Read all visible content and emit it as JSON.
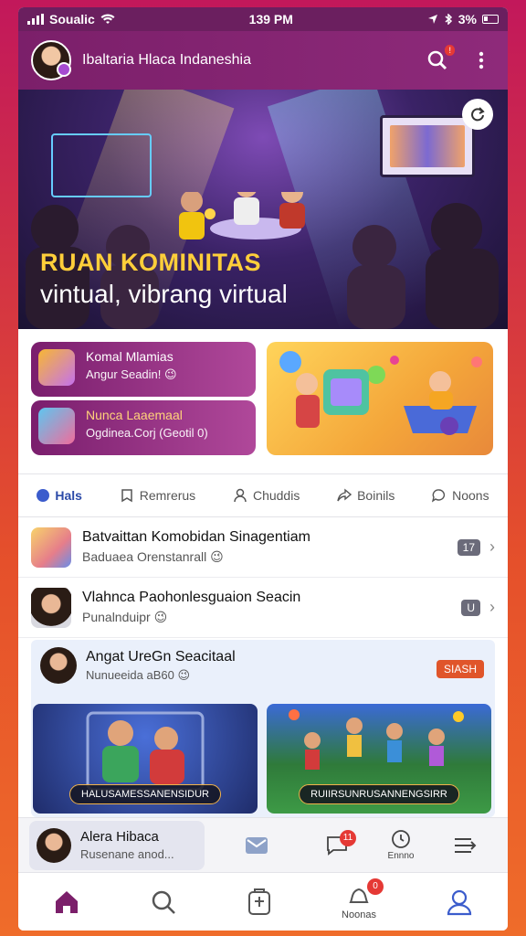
{
  "status_bar": {
    "carrier": "Soualic",
    "time": "139 PM",
    "battery": "3%"
  },
  "app_bar": {
    "title": "Ibaltaria Hlaca Indaneshia",
    "notification_count": "!"
  },
  "hero": {
    "title": "RUAN KOMINITAS",
    "subtitle": "vintual, vibrang virtual"
  },
  "promo_cards": [
    {
      "title": "Komal Mlamias",
      "subtitle": "Angur Seadin! 😉"
    },
    {
      "title": "Nunca Laaemaal",
      "subtitle": "Ogdinea.Corj (Geotil 0)"
    }
  ],
  "tabs": [
    {
      "label": "Hals",
      "icon": "dot-icon",
      "active": true
    },
    {
      "label": "Remrerus",
      "icon": "bookmark-icon",
      "active": false
    },
    {
      "label": "Chuddis",
      "icon": "person-icon",
      "active": false
    },
    {
      "label": "Boinils",
      "icon": "share-icon",
      "active": false
    },
    {
      "label": "Noons",
      "icon": "chat-icon",
      "active": false
    }
  ],
  "list_items": [
    {
      "title": "Batvaittan Komobidan Sinagentiam",
      "subtitle": "Baduaea Orenstanrall 😉",
      "tag": "17"
    },
    {
      "title": "Vlahnca Paohonlesguaion Seacin",
      "subtitle": "Punalnduipr 😉",
      "tag": "U"
    }
  ],
  "feature": {
    "title": "Angat UreGn Seacitaal",
    "subtitle": "Nunueeida aB60 😉",
    "button": "SIASH",
    "tiles": [
      {
        "caption": "HALUSAMESSANENSIDUR"
      },
      {
        "caption": "RUIIRSUNRUSANNENGSIRR"
      }
    ]
  },
  "dock": {
    "name": "Alera Hibaca",
    "status": "Rusenane anod...",
    "badge": "11",
    "item_label": "Ennno"
  },
  "bottom_nav": {
    "badge": "0",
    "label": "Noonas"
  },
  "colors": {
    "primary": "#7b1f6a",
    "accent": "#e0552a",
    "tab_active": "#2b4aa8"
  }
}
